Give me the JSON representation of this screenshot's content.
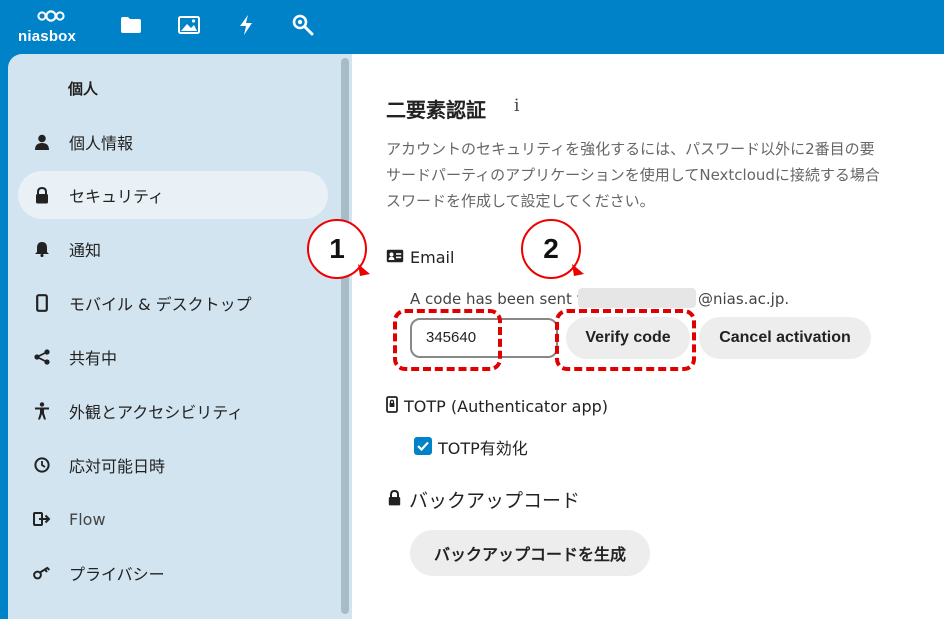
{
  "header": {
    "logo_text": "niasbox",
    "apps": [
      {
        "name": "files-icon"
      },
      {
        "name": "photos-icon"
      },
      {
        "name": "activity-icon"
      },
      {
        "name": "search-icon"
      }
    ]
  },
  "sidebar": {
    "heading": "個人",
    "items": [
      {
        "label": "個人情報",
        "icon": "user-icon"
      },
      {
        "label": "セキュリティ",
        "icon": "lock-icon",
        "active": true
      },
      {
        "label": "通知",
        "icon": "bell-icon"
      },
      {
        "label": "モバイル & デスクトップ",
        "icon": "phone-icon"
      },
      {
        "label": "共有中",
        "icon": "share-icon"
      },
      {
        "label": "外観とアクセシビリティ",
        "icon": "accessibility-icon"
      },
      {
        "label": "応対可能日時",
        "icon": "clock-icon"
      },
      {
        "label": "Flow",
        "icon": "flow-icon"
      },
      {
        "label": "プライバシー",
        "icon": "key-icon"
      }
    ]
  },
  "main": {
    "title": "二要素認証",
    "info_glyph": "i",
    "description": [
      "アカウントのセキュリティを強化するには、パスワード以外に2番目の要",
      "サードパーティのアプリケーションを使用してNextcloudに接続する場合",
      "スワードを作成して設定してください。"
    ],
    "email_provider": {
      "label": "Email",
      "sent_prefix": "A code has been sent to",
      "sent_domain": "@nias.ac.jp.",
      "code_value": "345640",
      "verify_label": "Verify code",
      "cancel_label": "Cancel activation"
    },
    "totp_provider": {
      "label": "TOTP (Authenticator app)",
      "checkbox_label": "TOTP有効化",
      "checked": true
    },
    "backup": {
      "title": "バックアップコード",
      "button_label": "バックアップコードを生成"
    }
  },
  "annotations": {
    "callout_1": "1",
    "callout_2": "2"
  }
}
